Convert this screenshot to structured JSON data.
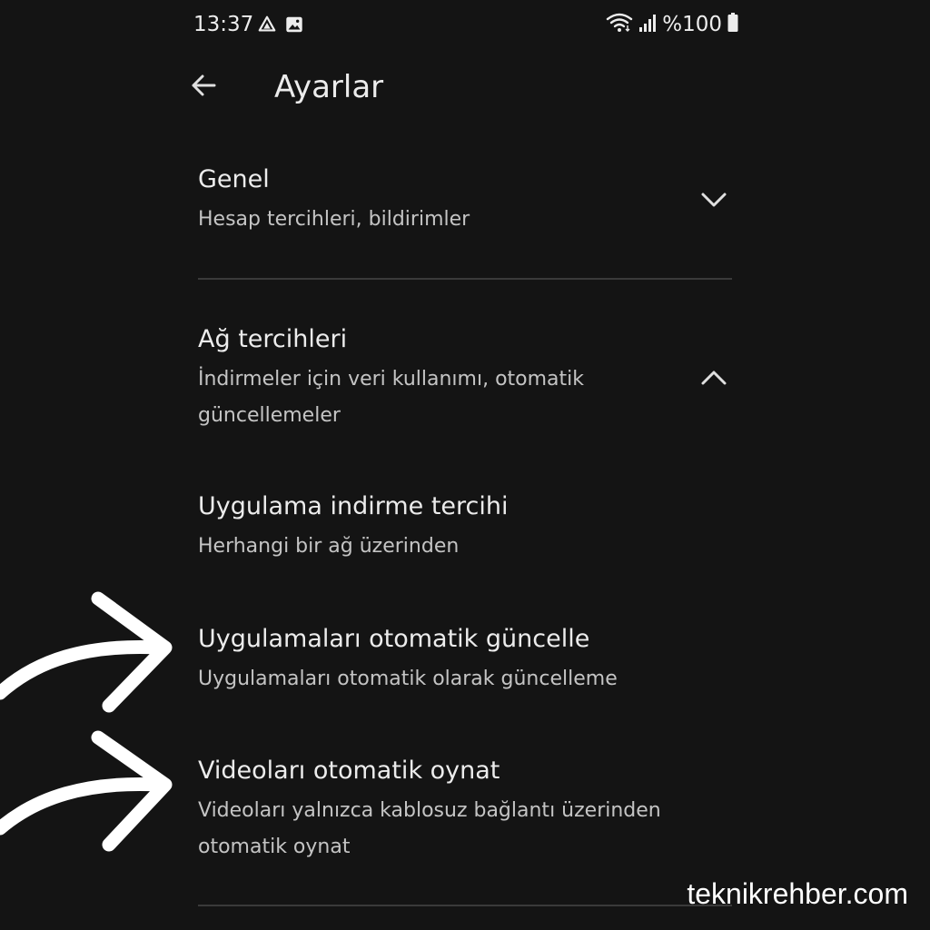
{
  "status_bar": {
    "time": "13:37",
    "left_icons": [
      "drive-icon",
      "image-icon"
    ],
    "right_icons": [
      "wifi-icon",
      "signal-icon",
      "battery-icon"
    ],
    "battery_text": "%100"
  },
  "app_bar": {
    "back_icon": "back-arrow-icon",
    "title": "Ayarlar"
  },
  "settings": [
    {
      "title": "Genel",
      "subtitle": "Hesap tercihleri, bildirimler",
      "chevron": "chevron-down-icon"
    },
    {
      "title": "Ağ tercihleri",
      "subtitle": "İndirmeler için veri kullanımı, otomatik güncellemeler",
      "chevron": "chevron-up-icon"
    },
    {
      "title": "Uygulama indirme tercihi",
      "subtitle": "Herhangi bir ağ üzerinden"
    },
    {
      "title": "Uygulamaları otomatik güncelle",
      "subtitle": "Uygulamaları otomatik olarak güncelleme"
    },
    {
      "title": "Videoları otomatik oynat",
      "subtitle": "Videoları yalnızca kablosuz bağlantı üzerinden otomatik oynat"
    }
  ],
  "overlay": {
    "arrow_icons": [
      "curved-arrow-icon",
      "curved-arrow-icon"
    ],
    "watermark": "teknikrehber.com"
  },
  "colors": {
    "background": "#141414",
    "text_primary": "#ececec",
    "text_secondary": "#c4c4c4",
    "divider": "#3a3a3a"
  }
}
